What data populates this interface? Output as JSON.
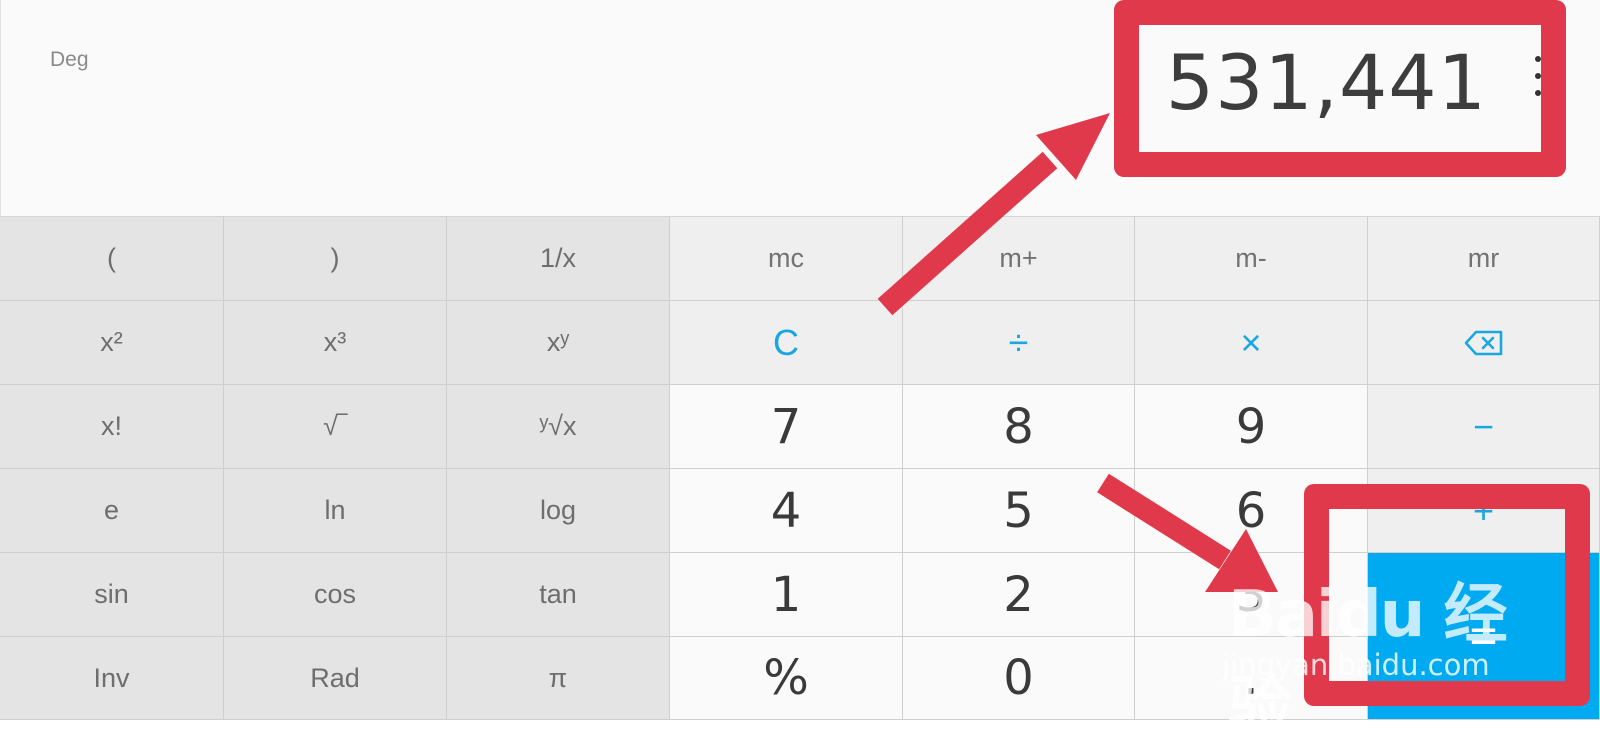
{
  "display": {
    "mode": "Deg",
    "result": "531,441",
    "menu_icon": "more-vertical-icon"
  },
  "keypad": {
    "row1": [
      "(",
      ")",
      "1/x",
      "mc",
      "m+",
      "m-",
      "mr"
    ],
    "row2": [
      "x²",
      "x³",
      "xʸ",
      "C",
      "÷",
      "×",
      "backspace-icon"
    ],
    "row3": [
      "x!",
      "√‾",
      "ʸ√x",
      "7",
      "8",
      "9",
      "−"
    ],
    "row4": [
      "e",
      "ln",
      "log",
      "4",
      "5",
      "6",
      "+"
    ],
    "row5": [
      "sin",
      "cos",
      "tan",
      "1",
      "2",
      "3",
      "="
    ],
    "row6": [
      "Inv",
      "Rad",
      "π",
      "%",
      "0",
      ".",
      "="
    ]
  },
  "watermark": {
    "brand": "Baidu 经验",
    "url": "jingyan.baidu.com"
  },
  "colors": {
    "accent": "#19a7e2",
    "equals": "#00aaf0",
    "annotation": "#e0394b"
  }
}
